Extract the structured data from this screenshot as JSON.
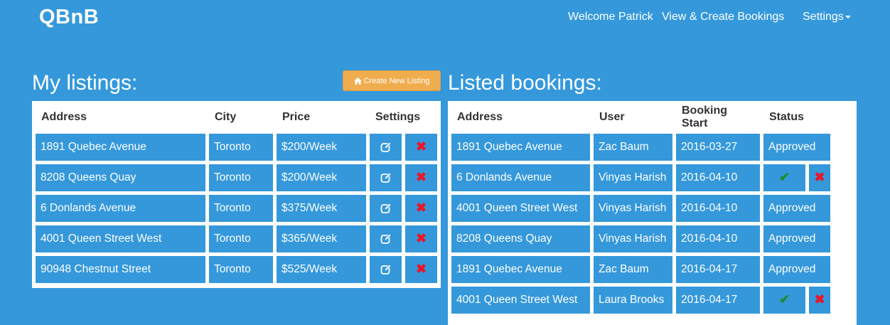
{
  "navbar": {
    "brand": "QBnB",
    "welcome": "Welcome Patrick",
    "bookings_link": "View & Create Bookings",
    "settings_menu": "Settings"
  },
  "listings": {
    "title": "My listings:",
    "create_button": "Create New Listing",
    "headers": {
      "address": "Address",
      "city": "City",
      "price": "Price",
      "settings": "Settings"
    },
    "rows": [
      {
        "address": "1891 Quebec Avenue",
        "city": "Toronto",
        "price": "$200/Week"
      },
      {
        "address": "8208 Queens Quay",
        "city": "Toronto",
        "price": "$200/Week"
      },
      {
        "address": "6 Donlands Avenue",
        "city": "Toronto",
        "price": "$375/Week"
      },
      {
        "address": "4001 Queen Street West",
        "city": "Toronto",
        "price": "$365/Week"
      },
      {
        "address": "90948 Chestnut Street",
        "city": "Toronto",
        "price": "$525/Week"
      }
    ],
    "edit_icon": "edit-icon",
    "delete_icon": "x-icon"
  },
  "bookings": {
    "title": "Listed bookings:",
    "headers": {
      "address": "Address",
      "user": "User",
      "start": "Booking Start",
      "status": "Status"
    },
    "rows": [
      {
        "address": "1891 Quebec Avenue",
        "user": "Zac Baum",
        "start": "2016-03-27",
        "status": "Approved"
      },
      {
        "address": "6 Donlands Avenue",
        "user": "Vinyas Harish",
        "start": "2016-04-10",
        "status": ""
      },
      {
        "address": "4001 Queen Street West",
        "user": "Vinyas Harish",
        "start": "2016-04-10",
        "status": "Approved"
      },
      {
        "address": "8208 Queens Quay",
        "user": "Vinyas Harish",
        "start": "2016-04-10",
        "status": "Approved"
      },
      {
        "address": "1891 Quebec Avenue",
        "user": "Zac Baum",
        "start": "2016-04-17",
        "status": "Approved"
      },
      {
        "address": "4001 Queen Street West",
        "user": "Laura Brooks",
        "start": "2016-04-17",
        "status": ""
      }
    ],
    "approve_icon": "check-icon",
    "reject_icon": "x-icon"
  },
  "colors": {
    "background": "#3498db",
    "cell": "#3498db",
    "create_button": "#f0ad4e",
    "delete": "#e8172a",
    "approve": "#1e8c2e"
  }
}
